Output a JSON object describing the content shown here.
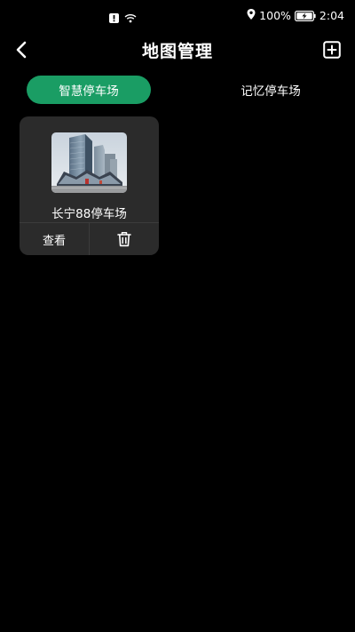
{
  "status_bar": {
    "alert_icon": "alert-box-icon",
    "wifi_icon": "wifi-icon",
    "location_icon": "location-pin-icon",
    "battery_percent": "100%",
    "battery_icon": "battery-charging-icon",
    "time": "2:04"
  },
  "header": {
    "title": "地图管理",
    "back_icon": "chevron-left-icon",
    "add_icon": "add-square-icon"
  },
  "tabs": [
    {
      "label": "智慧停车场",
      "active": true
    },
    {
      "label": "记忆停车场",
      "active": false
    }
  ],
  "lots": [
    {
      "name": "长宁88停车场",
      "view_label": "查看",
      "delete_icon": "trash-icon"
    }
  ],
  "colors": {
    "background": "#000000",
    "card": "#2b2b2b",
    "accent": "#1a9d64",
    "text": "#ffffff"
  }
}
